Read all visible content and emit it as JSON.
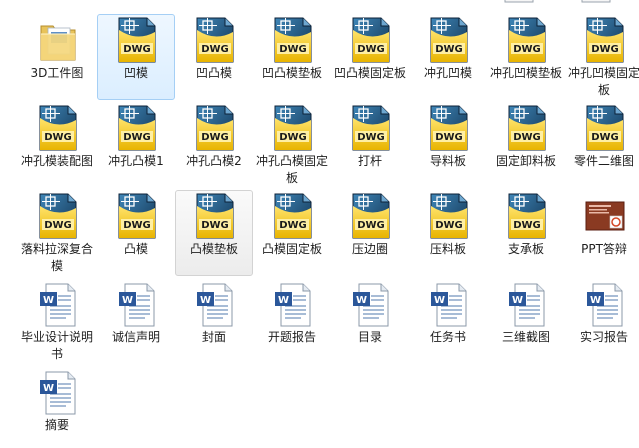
{
  "window": {
    "type": "explorer-file-view"
  },
  "files": [
    {
      "name": "3D工件图",
      "type": "folder",
      "state": ""
    },
    {
      "name": "凹模",
      "type": "dwg",
      "state": "selected"
    },
    {
      "name": "凹凸模",
      "type": "dwg",
      "state": ""
    },
    {
      "name": "凹凸模垫板",
      "type": "dwg",
      "state": ""
    },
    {
      "name": "凹凸模固定板",
      "type": "dwg",
      "state": ""
    },
    {
      "name": "冲孔凹模",
      "type": "dwg",
      "state": ""
    },
    {
      "name": "冲孔凹模垫板",
      "type": "dwg",
      "state": ""
    },
    {
      "name": "冲孔凹模固定板",
      "type": "dwg",
      "state": ""
    },
    {
      "name": "冲孔模装配图",
      "type": "dwg",
      "state": ""
    },
    {
      "name": "冲孔凸模1",
      "type": "dwg",
      "state": ""
    },
    {
      "name": "冲孔凸模2",
      "type": "dwg",
      "state": ""
    },
    {
      "name": "冲孔凸模固定板",
      "type": "dwg",
      "state": ""
    },
    {
      "name": "打杆",
      "type": "dwg",
      "state": ""
    },
    {
      "name": "导料板",
      "type": "dwg",
      "state": ""
    },
    {
      "name": "固定卸料板",
      "type": "dwg",
      "state": ""
    },
    {
      "name": "零件二维图",
      "type": "dwg",
      "state": ""
    },
    {
      "name": "落料拉深复合模",
      "type": "dwg",
      "state": ""
    },
    {
      "name": "凸模",
      "type": "dwg",
      "state": ""
    },
    {
      "name": "凸模垫板",
      "type": "dwg",
      "state": "hovered"
    },
    {
      "name": "凸模固定板",
      "type": "dwg",
      "state": ""
    },
    {
      "name": "压边圈",
      "type": "dwg",
      "state": ""
    },
    {
      "name": "压料板",
      "type": "dwg",
      "state": ""
    },
    {
      "name": "支承板",
      "type": "dwg",
      "state": ""
    },
    {
      "name": "PPT答辩",
      "type": "ppt",
      "state": ""
    },
    {
      "name": "毕业设计说明书",
      "type": "doc",
      "state": ""
    },
    {
      "name": "诚信声明",
      "type": "doc",
      "state": ""
    },
    {
      "name": "封面",
      "type": "doc",
      "state": ""
    },
    {
      "name": "开题报告",
      "type": "doc",
      "state": ""
    },
    {
      "name": "目录",
      "type": "doc",
      "state": ""
    },
    {
      "name": "任务书",
      "type": "doc",
      "state": ""
    },
    {
      "name": "三维截图",
      "type": "doc",
      "state": ""
    },
    {
      "name": "实习报告",
      "type": "doc",
      "state": ""
    },
    {
      "name": "摘要",
      "type": "doc",
      "state": ""
    }
  ],
  "icons": {
    "dwg_badge": "DWG",
    "dwg_icon": "dwg-file-icon",
    "doc_icon": "word-document-icon",
    "folder_icon": "folder-icon",
    "ppt_icon": "powerpoint-file-icon"
  },
  "colors": {
    "selected_bg": "#dbeeff",
    "selected_border": "#a5cff5",
    "hover_bg": "#ececec",
    "dwg_yellow": "#f3c300",
    "word_blue": "#2b579a"
  }
}
